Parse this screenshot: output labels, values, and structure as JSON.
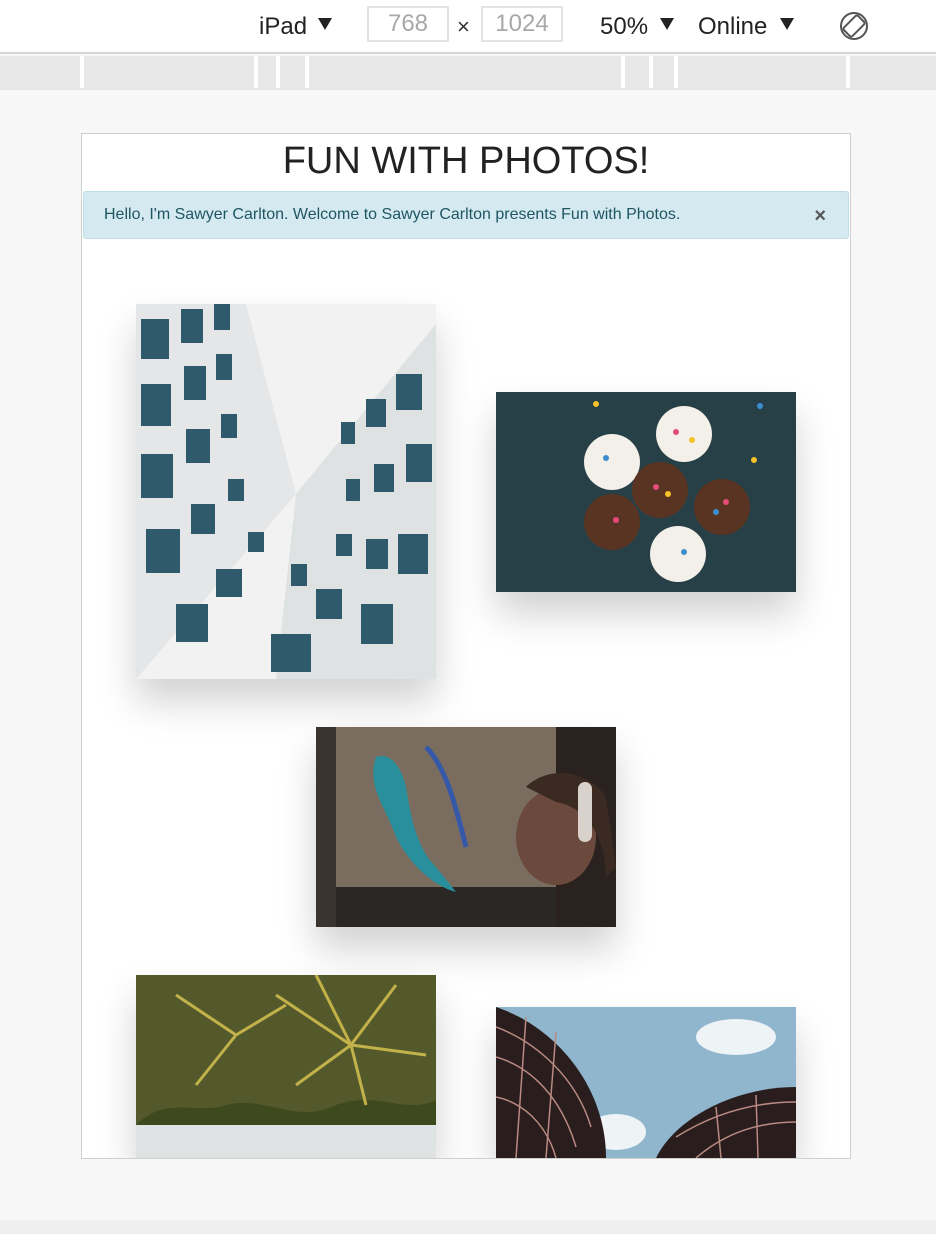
{
  "toolbar": {
    "device": "iPad",
    "width": "768",
    "height": "1024",
    "times": "×",
    "zoom": "50%",
    "network": "Online",
    "rotate_icon": "rotate-device-icon"
  },
  "page": {
    "title": "FUN WITH PHOTOS!",
    "alert": {
      "message": "Hello, I'm Sawyer Carlton. Welcome to Sawyer Carlton presents Fun with Photos.",
      "close": "×"
    },
    "photos": [
      {
        "name": "building-facade-photo"
      },
      {
        "name": "cupcakes-photo"
      },
      {
        "name": "street-art-girl-photo"
      },
      {
        "name": "palm-trees-photo"
      },
      {
        "name": "curved-buildings-photo"
      }
    ]
  },
  "colors": {
    "alert_bg": "#d4eaf0",
    "alert_text": "#1f5562",
    "toolbar_bg": "#ffffff"
  }
}
